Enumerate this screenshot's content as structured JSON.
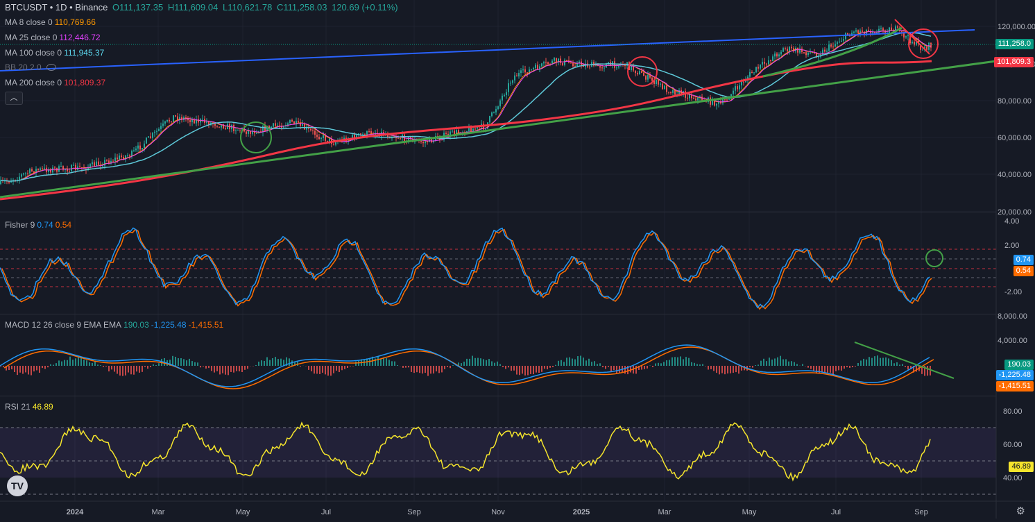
{
  "header": {
    "symbol": "BTCUSDT • 1D • Binance",
    "open": "O111,137.35",
    "high": "H111,609.04",
    "low": "L110,621.78",
    "close": "C111,258.03",
    "change": "120.69 (+0.11%)"
  },
  "indicators": [
    {
      "label": "MA 8 close 0",
      "value": "110,769.66",
      "color": "#ff9800"
    },
    {
      "label": "MA 25 close 0",
      "value": "112,446.72",
      "color": "#e040fb"
    },
    {
      "label": "MA 100 close 0",
      "value": "111,945.37",
      "color": "#5dd9f0"
    },
    {
      "label": "BB 20 2 0",
      "value": "",
      "color": "#787b86"
    },
    {
      "label": "MA 200 close 0",
      "value": "101,809.37",
      "color": "#f23645"
    }
  ],
  "collapse_icon": "chevron-up",
  "price_axis": {
    "ticks": [
      "120,000.00",
      "100,000.00",
      "80,000.00",
      "60,000.00",
      "40,000.00",
      "20,000.00"
    ]
  },
  "price_tags": [
    {
      "value": "111,258.0",
      "color": "#089981"
    },
    {
      "value": "101,809.3",
      "color": "#f23645"
    }
  ],
  "fisher": {
    "label": "Fisher 9",
    "v1": "0.74",
    "v2": "0.54",
    "ticks": [
      "4.00",
      "2.00",
      "-2.00"
    ],
    "tag1": "0.74",
    "tag2": "0.54"
  },
  "macd": {
    "label": "MACD 12 26 close 9 EMA EMA",
    "hist": "190.03",
    "macd": "-1,225.48",
    "signal": "-1,415.51",
    "ticks": [
      "8,000.00",
      "4,000.00"
    ],
    "tag_hist": "190.03",
    "tag_macd": "-1,225.48",
    "tag_signal": "-1,415.51"
  },
  "rsi": {
    "label": "RSI 21",
    "value": "46.89",
    "ticks": [
      "80.00",
      "60.00",
      "40.00"
    ],
    "tag": "46.89"
  },
  "time_axis": [
    "2024",
    "Mar",
    "May",
    "Jul",
    "Sep",
    "Nov",
    "2025",
    "Mar",
    "May",
    "Jul",
    "Sep"
  ],
  "logo_text": "TV",
  "settings_icon": "gear"
}
